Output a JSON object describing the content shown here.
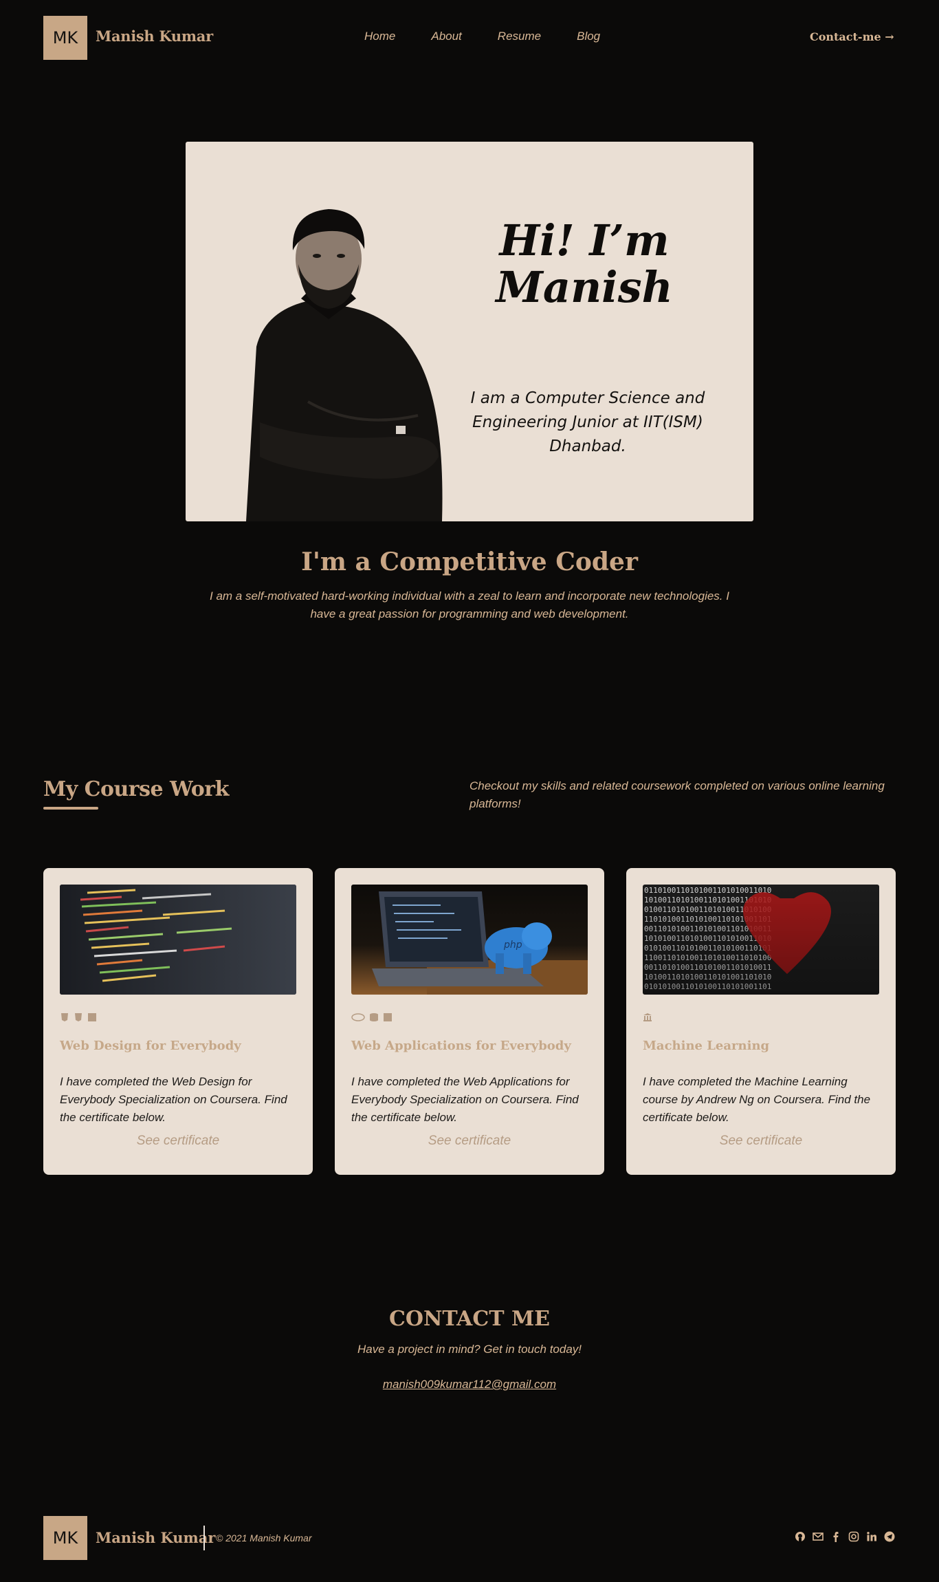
{
  "nav": {
    "logo": "MK",
    "brand": "Manish Kumar",
    "links": [
      "Home",
      "About",
      "Resume",
      "Blog"
    ],
    "contact": "Contact-me →"
  },
  "hero": {
    "greeting": "Hi! I’m Manish",
    "subtitle": "I am a Computer Science and Engineering Junior at IIT(ISM) Dhanbad.",
    "headline": "I'm a Competitive Coder",
    "intro": "I am a self-motivated hard-working individual with a zeal to learn and incorporate new technologies. I have a great passion for programming and web development."
  },
  "coursework": {
    "title": "My Course Work",
    "description": "Checkout my skills and related coursework completed on various online learning platforms!",
    "cards": [
      {
        "title": "Web Design for Everybody",
        "text": "I have completed the Web Design for Everybody Specialization on Coursera. Find the certificate below.",
        "link": "See certificate",
        "icons": [
          "html5-icon",
          "css3-icon",
          "javascript-icon"
        ]
      },
      {
        "title": "Web Applications for Everybody",
        "text": "I have completed the Web Applications for Everybody Specialization on Coursera. Find the certificate below.",
        "link": "See certificate",
        "icons": [
          "php-icon",
          "database-icon",
          "javascript-icon"
        ]
      },
      {
        "title": "Machine Learning",
        "text": "I have completed the Machine Learning course by Andrew Ng on Coursera. Find the certificate below.",
        "link": "See certificate",
        "icons": [
          "university-icon"
        ]
      }
    ]
  },
  "contact": {
    "title": "CONTACT ME",
    "subtitle": "Have a project in mind? Get in touch today!",
    "email": "manish009kumar112@gmail.com"
  },
  "footer": {
    "logo": "MK",
    "brand": "Manish Kumar",
    "copyright": "© 2021 Manish Kumar",
    "socials": [
      "github-icon",
      "mail-icon",
      "facebook-icon",
      "instagram-icon",
      "linkedin-icon",
      "telegram-icon"
    ]
  }
}
